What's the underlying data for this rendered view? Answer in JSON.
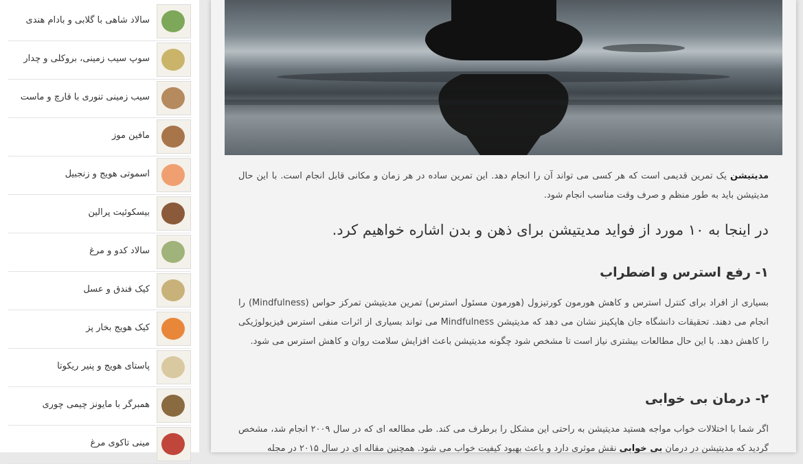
{
  "sidebar": {
    "items": [
      {
        "label": "سالاد شاهی با گلابی و بادام هندی",
        "color": "#7da85a"
      },
      {
        "label": "سوپ سیب زمینی، بروکلی و چدار",
        "color": "#c9b46a"
      },
      {
        "label": "سیب زمینی تنوری با قارچ و ماست",
        "color": "#b58a5e"
      },
      {
        "label": "مافین موز",
        "color": "#a8754a"
      },
      {
        "label": "اسموتی هویج و زنجبیل",
        "color": "#f0a070"
      },
      {
        "label": "بیسکوئیت پرالین",
        "color": "#8a5a3a"
      },
      {
        "label": "سالاد کدو و مرغ",
        "color": "#9fb37a"
      },
      {
        "label": "کیک فندق و عسل",
        "color": "#c8b27a"
      },
      {
        "label": "کیک هویج بخار پز",
        "color": "#e8873a"
      },
      {
        "label": "پاستای هویج و پنیر ریکوتا",
        "color": "#d9c9a0"
      },
      {
        "label": "همبرگر با مایونز چیمی چوری",
        "color": "#8a6a40"
      },
      {
        "label": "مینی تاکوی مرغ",
        "color": "#c0453a"
      }
    ]
  },
  "article": {
    "intro_bold": "مدیتیشن",
    "intro_rest": " یک تمرین قدیمی است که هر کسی می تواند آن را انجام دهد. این تمرین ساده در هر زمان و مکانی قابل انجام است. با این حال مدیتیشن باید به طور منظم و صرف وقت مناسب انجام شود.",
    "heading": "در اینجا به ۱۰ مورد از فواید مدیتیشن برای ذهن و بدن اشاره خواهیم کرد.",
    "section1_title": "۱- رفع استرس و اضطراب",
    "section1_text": "بسیاری از افراد برای کنترل استرس و کاهش هورمون کورتیزول (هورمون مسئول استرس) تمرین مدیتیشن تمرکز حواس (Mindfulness) را انجام می دهند. تحقیقات دانشگاه جان هاپکینز نشان می دهد که مدیتیشن Mindfulness می تواند بسیاری از اثرات منفی استرس فیزیولوژیکی را کاهش دهد. با این حال مطالعات بیشتری نیاز است تا مشخص شود چگونه مدیتیشن باعث افزایش سلامت روان و کاهش استرس می شود.",
    "section2_title": "۲- درمان بی خوابی",
    "section2_text_a": "اگر شما با اختلالات خواب مواجه هستید مدیتیشن به راحتی این مشکل را برطرف می کند. طی مطالعه ای که در سال ۲۰۰۹ انجام شد، مشخص گردید که مدیتیشن در درمان ",
    "section2_bold": "بی خوابی",
    "section2_text_b": " نقش موثری دارد و باعث بهبود کیفیت خواب می شود. همچنین مقاله ای در سال ۲۰۱۵ در مجله"
  }
}
